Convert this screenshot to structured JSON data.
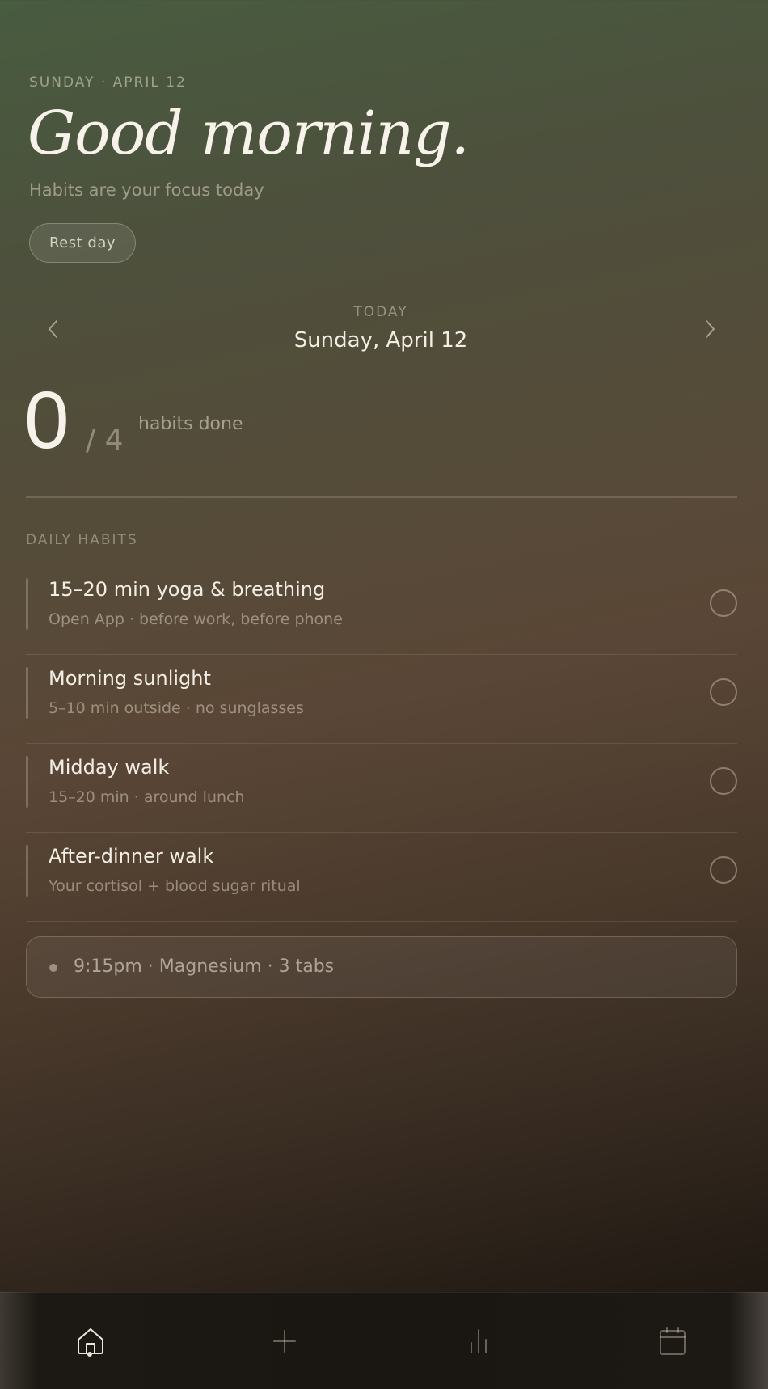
{
  "header": {
    "date_kicker": "SUNDAY · APRIL 12",
    "greeting": "Good morning.",
    "subtitle": "Habits are your focus today",
    "rest_day_label": "Rest day"
  },
  "day_nav": {
    "kicker": "TODAY",
    "date": "Sunday, April 12",
    "prev_icon": "chevron-left-icon",
    "next_icon": "chevron-right-icon"
  },
  "progress": {
    "done": "0",
    "total": "/ 4",
    "label": "habits done"
  },
  "habits": {
    "section_title": "DAILY HABITS",
    "items": [
      {
        "title": "15–20 min yoga & breathing",
        "subtitle": "Open App · before work, before phone",
        "done": false
      },
      {
        "title": "Morning sunlight",
        "subtitle": "5–10 min outside · no sunglasses",
        "done": false
      },
      {
        "title": "Midday walk",
        "subtitle": "15–20 min · around lunch",
        "done": false
      },
      {
        "title": "After-dinner walk",
        "subtitle": "Your cortisol + blood sugar ritual",
        "done": false
      }
    ]
  },
  "reminder": {
    "text": "9:15pm · Magnesium · 3 tabs"
  },
  "tabbar": {
    "active": "home",
    "items": [
      {
        "key": "home",
        "icon": "home-icon"
      },
      {
        "key": "add",
        "icon": "plus-icon"
      },
      {
        "key": "stats",
        "icon": "bar-chart-icon"
      },
      {
        "key": "calendar",
        "icon": "calendar-icon"
      }
    ]
  },
  "colors": {
    "text_primary": "#f3eee4",
    "bg_top": "#485c40",
    "bg_mid": "#5a4636",
    "bg_bottom": "#1c1712"
  }
}
